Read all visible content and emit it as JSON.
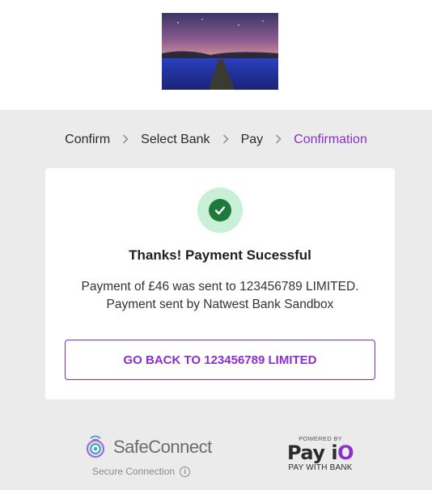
{
  "hero": {
    "alt": "night sky over a field of blue flowers"
  },
  "breadcrumb": {
    "steps": [
      "Confirm",
      "Select Bank",
      "Pay",
      "Confirmation"
    ],
    "active_index": 3
  },
  "card": {
    "title": "Thanks! Payment Sucessful",
    "message_line1": "Payment of £46 was sent to 123456789 LIMITED.",
    "message_line2": "Payment sent by Natwest Bank Sandbox",
    "button_label": "GO BACK TO 123456789 LIMITED"
  },
  "footer": {
    "safeconnect_name": "SafeConnect",
    "secure_label": "Secure Connection",
    "powered_by": "POWERED BY",
    "payio_brand": "Pay iO",
    "pay_with_bank": "PAY WITH BANK"
  },
  "colors": {
    "accent": "#8b2fc9",
    "success": "#1e7a3c",
    "success_bg": "#c7f0d6",
    "page_bg": "#ebebeb"
  }
}
